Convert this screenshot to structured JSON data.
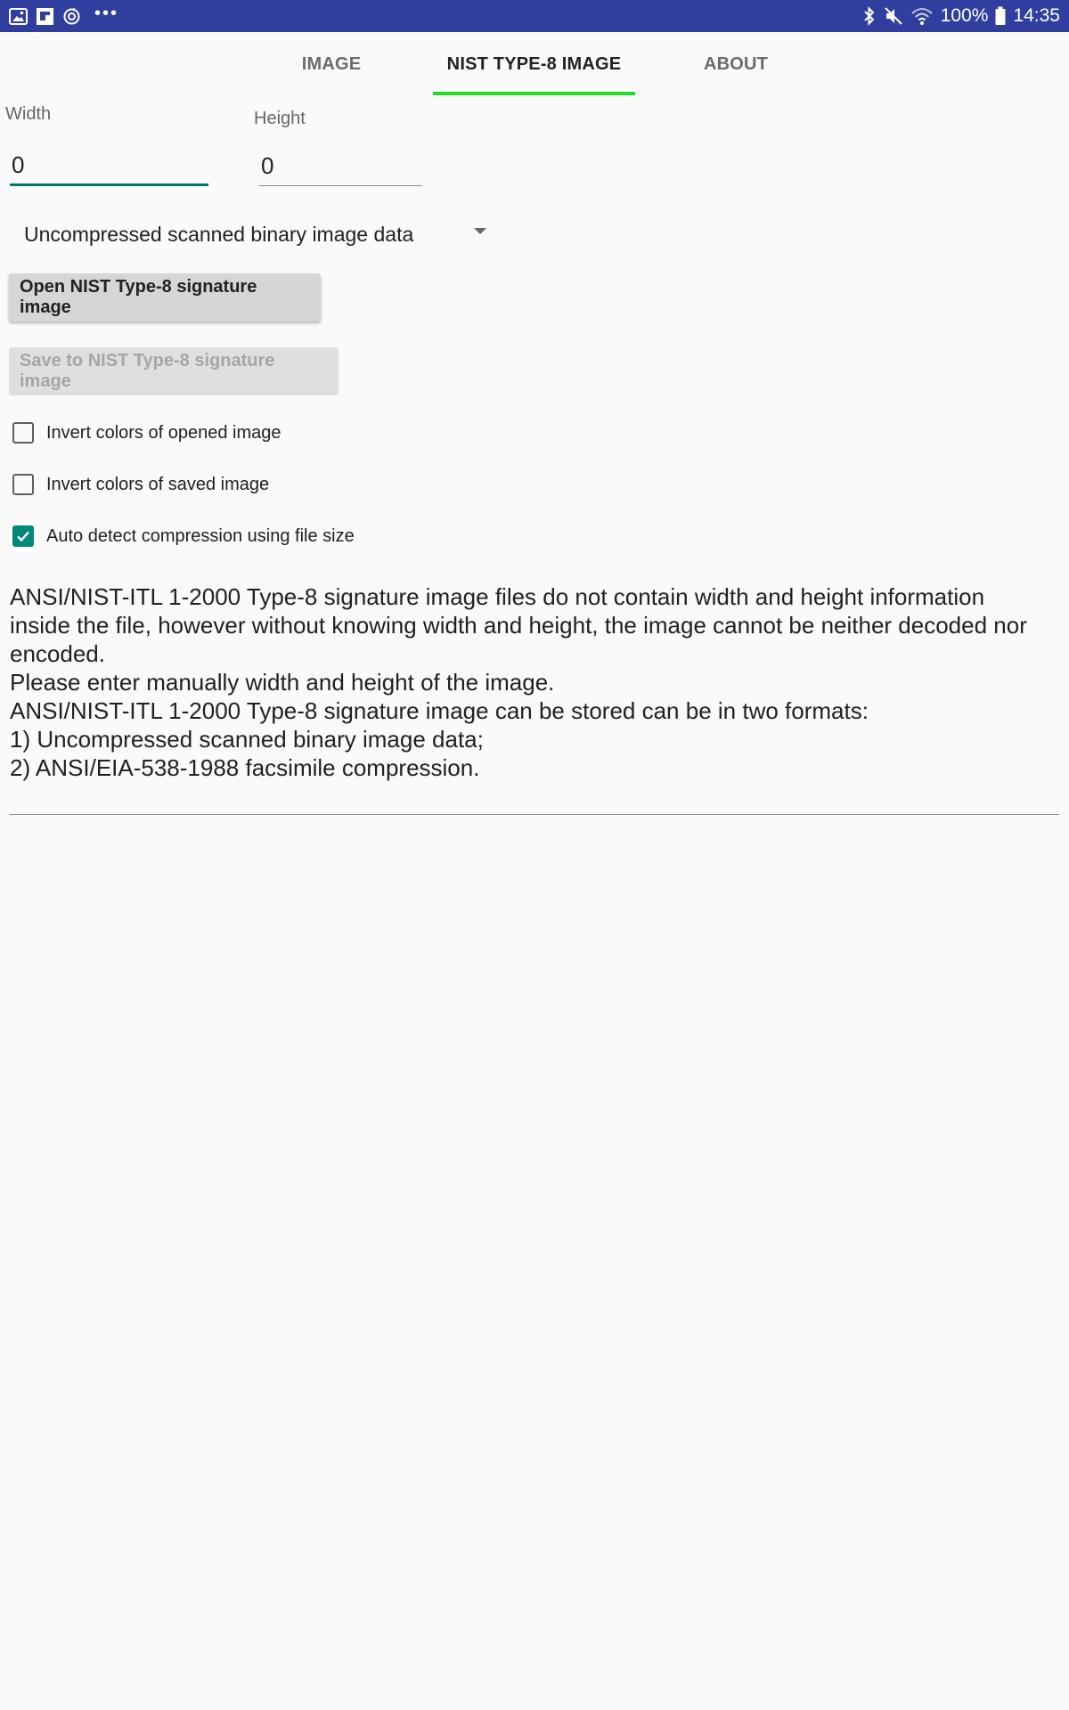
{
  "status_bar": {
    "battery_percent": "100%",
    "time": "14:35",
    "icons_left": [
      "gallery-icon",
      "flipboard-icon",
      "sync-icon"
    ],
    "overflow_dots": "•••",
    "icons_right": [
      "bluetooth-icon",
      "mute-icon",
      "wifi-icon",
      "battery-icon"
    ]
  },
  "tabs": [
    {
      "label": "IMAGE",
      "active": false
    },
    {
      "label": "NIST TYPE-8 IMAGE",
      "active": true
    },
    {
      "label": "ABOUT",
      "active": false
    }
  ],
  "accent_color": "#22dd22",
  "form": {
    "width_label": "Width",
    "width_value": "0",
    "height_label": "Height",
    "height_value": "0"
  },
  "compression_spinner": {
    "selected": "Uncompressed scanned binary image data"
  },
  "buttons": {
    "open_label": "Open NIST Type-8 signature image",
    "save_label": "Save to NIST Type-8 signature image",
    "save_enabled": false
  },
  "checkboxes": [
    {
      "label": "Invert colors of opened image",
      "checked": false
    },
    {
      "label": "Invert colors of saved image",
      "checked": false
    },
    {
      "label": "Auto detect compression using file size",
      "checked": true
    }
  ],
  "description": {
    "lines": [
      "ANSI/NIST-ITL 1-2000 Type-8 signature image files do not contain width and height information inside the file, however without knowing width and height, the image cannot be neither decoded nor encoded.",
      "Please enter manually width and height of the image.",
      "ANSI/NIST-ITL 1-2000 Type-8 signature image can be stored can be in two formats:",
      "1) Uncompressed scanned binary image data;",
      "2) ANSI/EIA-538-1988 facsimile compression."
    ]
  }
}
